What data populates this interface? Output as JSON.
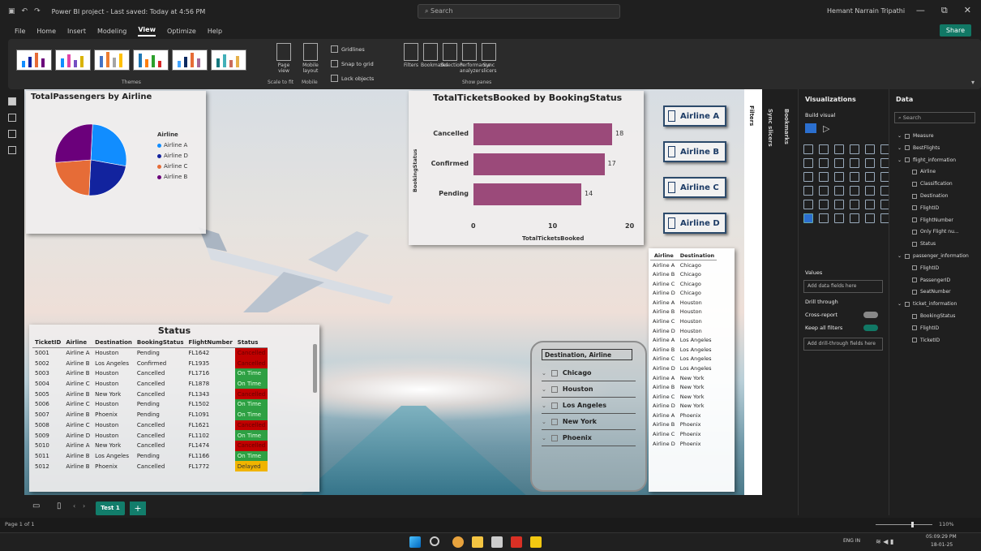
{
  "titlebar": {
    "doc_title": "Power BI project - Last saved: Today at 4:56 PM",
    "search_placeholder": "Search",
    "user": "Hemant Narrain Tripathi"
  },
  "menu": {
    "items": [
      "File",
      "Home",
      "Insert",
      "Modeling",
      "View",
      "Optimize",
      "Help"
    ],
    "share_label": "Share"
  },
  "ribbon": {
    "themes_label": "Themes",
    "page_view_label": "Page view",
    "mobile_layout_label": "Mobile layout",
    "scale_label": "Scale to fit",
    "mobile_label": "Mobile",
    "gridlines_label": "Gridlines",
    "snap_label": "Snap to grid",
    "lock_label": "Lock objects",
    "page_options_label": "Page options",
    "panes": [
      "Filters",
      "Bookmarks",
      "Selection",
      "Performance analyzer",
      "Sync slicers"
    ],
    "show_panes_label": "Show panes"
  },
  "pie": {
    "title": "TotalPassengers by Airline",
    "legend_title": "Airline",
    "legend": [
      "Airline A",
      "Airline D",
      "Airline C",
      "Airline B"
    ],
    "colors": [
      "#118dff",
      "#12239e",
      "#e66c37",
      "#6b007b"
    ]
  },
  "chart_data": {
    "type": "bar",
    "title": "TotalTicketsBooked by BookingStatus",
    "xlabel": "TotalTicketsBooked",
    "ylabel": "BookingStatus",
    "categories": [
      "Cancelled",
      "Confirmed",
      "Pending"
    ],
    "values": [
      18,
      17,
      14
    ],
    "xlim": [
      0,
      20
    ],
    "xticks": [
      "0",
      "10",
      "20"
    ],
    "color": "#9b4a7a"
  },
  "airline_slicer": [
    "Airline A",
    "Airline B",
    "Airline C",
    "Airline D"
  ],
  "status_table": {
    "title": "Status",
    "headers": [
      "TicketID",
      "Airline",
      "Destination",
      "BookingStatus",
      "FlightNumber",
      "Status"
    ],
    "rows": [
      [
        "5001",
        "Airline A",
        "Houston",
        "Pending",
        "FL1642",
        "Cancelled"
      ],
      [
        "5002",
        "Airline B",
        "Los Angeles",
        "Confirmed",
        "FL1935",
        "Cancelled"
      ],
      [
        "5003",
        "Airline B",
        "Houston",
        "Cancelled",
        "FL1716",
        "On Time"
      ],
      [
        "5004",
        "Airline C",
        "Houston",
        "Cancelled",
        "FL1878",
        "On Time"
      ],
      [
        "5005",
        "Airline B",
        "New York",
        "Cancelled",
        "FL1343",
        "Cancelled"
      ],
      [
        "5006",
        "Airline C",
        "Houston",
        "Pending",
        "FL1502",
        "On Time"
      ],
      [
        "5007",
        "Airline B",
        "Phoenix",
        "Pending",
        "FL1091",
        "On Time"
      ],
      [
        "5008",
        "Airline C",
        "Houston",
        "Cancelled",
        "FL1621",
        "Cancelled"
      ],
      [
        "5009",
        "Airline D",
        "Houston",
        "Cancelled",
        "FL1102",
        "On Time"
      ],
      [
        "5010",
        "Airline A",
        "New York",
        "Cancelled",
        "FL1474",
        "Cancelled"
      ],
      [
        "5011",
        "Airline B",
        "Los Angeles",
        "Pending",
        "FL1166",
        "On Time"
      ],
      [
        "5012",
        "Airline B",
        "Phoenix",
        "Cancelled",
        "FL1772",
        "Delayed"
      ]
    ]
  },
  "dest_table": {
    "headers": [
      "Airline",
      "Destination"
    ],
    "rows": [
      [
        "Airline A",
        "Chicago"
      ],
      [
        "Airline B",
        "Chicago"
      ],
      [
        "Airline C",
        "Chicago"
      ],
      [
        "Airline D",
        "Chicago"
      ],
      [
        "Airline A",
        "Houston"
      ],
      [
        "Airline B",
        "Houston"
      ],
      [
        "Airline C",
        "Houston"
      ],
      [
        "Airline D",
        "Houston"
      ],
      [
        "Airline A",
        "Los Angeles"
      ],
      [
        "Airline B",
        "Los Angeles"
      ],
      [
        "Airline C",
        "Los Angeles"
      ],
      [
        "Airline D",
        "Los Angeles"
      ],
      [
        "Airline A",
        "New York"
      ],
      [
        "Airline B",
        "New York"
      ],
      [
        "Airline C",
        "New York"
      ],
      [
        "Airline D",
        "New York"
      ],
      [
        "Airline A",
        "Phoenix"
      ],
      [
        "Airline B",
        "Phoenix"
      ],
      [
        "Airline C",
        "Phoenix"
      ],
      [
        "Airline D",
        "Phoenix"
      ]
    ]
  },
  "hierarchy_slicer": {
    "header": "Destination, Airline",
    "items": [
      "Chicago",
      "Houston",
      "Los Angeles",
      "New York",
      "Phoenix"
    ]
  },
  "filters_label": "Filters",
  "bookmarks_label": "Bookmarks",
  "sync_label": "Sync slicers",
  "viz_pane": {
    "title": "Visualizations",
    "build_label": "Build visual",
    "values_label": "Values",
    "add_fields": "Add data fields here",
    "drill_label": "Drill through",
    "cross_report": "Cross-report",
    "keep_filters": "Keep all filters",
    "add_drill": "Add drill-through fields here"
  },
  "data_pane": {
    "title": "Data",
    "search": "Search",
    "fields": [
      {
        "label": "Measure",
        "indent": 0
      },
      {
        "label": "BestFlights",
        "indent": 0
      },
      {
        "label": "flight_information",
        "indent": 0
      },
      {
        "label": "Airline",
        "indent": 1
      },
      {
        "label": "Classification",
        "indent": 1
      },
      {
        "label": "Destination",
        "indent": 1
      },
      {
        "label": "FlightID",
        "indent": 1
      },
      {
        "label": "FlightNumber",
        "indent": 1
      },
      {
        "label": "Only Flight nu...",
        "indent": 1
      },
      {
        "label": "Status",
        "indent": 1
      },
      {
        "label": "passenger_information",
        "indent": 0
      },
      {
        "label": "FlightID",
        "indent": 1
      },
      {
        "label": "PassengerID",
        "indent": 1
      },
      {
        "label": "SeatNumber",
        "indent": 1
      },
      {
        "label": "ticket_information",
        "indent": 0
      },
      {
        "label": "BookingStatus",
        "indent": 1
      },
      {
        "label": "FlightID",
        "indent": 1
      },
      {
        "label": "TicketID",
        "indent": 1
      }
    ]
  },
  "bottom": {
    "page_tab": "Test 1",
    "page_count": "Page 1 of 1",
    "zoom": "110%"
  },
  "taskbar": {
    "lang": "ENG IN",
    "time": "05:09:29 PM",
    "date": "18-01-25"
  }
}
